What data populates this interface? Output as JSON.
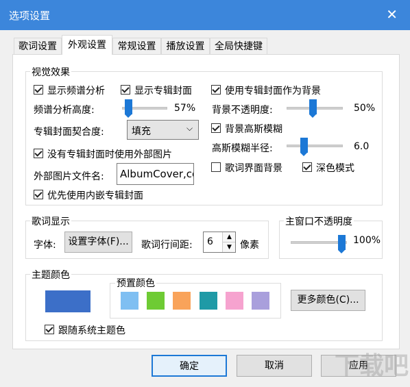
{
  "window": {
    "title": "选项设置",
    "close_glyph": "✕"
  },
  "tabs": [
    {
      "label": "歌词设置",
      "active": false
    },
    {
      "label": "外观设置",
      "active": true
    },
    {
      "label": "常规设置",
      "active": false
    },
    {
      "label": "播放设置",
      "active": false
    },
    {
      "label": "全局快捷键",
      "active": false
    }
  ],
  "visual": {
    "title": "视觉效果",
    "show_spectrum": {
      "label": "显示频谱分析",
      "checked": true
    },
    "show_cover": {
      "label": "显示专辑封面",
      "checked": true
    },
    "spectrum_height": {
      "label": "频谱分析高度:",
      "value": "57%",
      "level": 57
    },
    "cover_fit": {
      "label": "专辑封面契合度:",
      "value": "填充"
    },
    "use_external": {
      "label": "没有专辑封面时使用外部图片",
      "checked": true
    },
    "external_name": {
      "label": "外部图片文件名:",
      "value": "AlbumCover,co"
    },
    "prefer_embedded": {
      "label": "优先使用内嵌专辑封面",
      "checked": true
    },
    "cover_as_bg": {
      "label": "使用专辑封面作为背景",
      "checked": true
    },
    "bg_opacity": {
      "label": "背景不透明度:",
      "value": "50%",
      "level": 50
    },
    "bg_blur": {
      "label": "背景高斯模糊",
      "checked": true
    },
    "blur_radius": {
      "label": "高斯模糊半径:",
      "value": "6.0",
      "level": 30
    },
    "lyric_bg": {
      "label": "歌词界面背景",
      "checked": false
    },
    "dark_mode": {
      "label": "深色模式",
      "checked": true
    }
  },
  "lyrics_display": {
    "title": "歌词显示",
    "font_label": "字体:",
    "set_font_button": "设置字体(F)...",
    "spacing_label": "歌词行间距:",
    "spacing_value": "6",
    "unit": "像素"
  },
  "window_opacity": {
    "title": "主窗口不透明度",
    "value": "100%",
    "level": 100
  },
  "theme": {
    "title": "主题颜色",
    "current_color": "#3c6fc8",
    "preset_title": "预置颜色",
    "presets": [
      "#7fbff2",
      "#6ecb34",
      "#f9a35a",
      "#1f9aa6",
      "#f6a3cf",
      "#a99fdc"
    ],
    "more_button": "更多颜色(C)...",
    "follow_system": {
      "label": "跟随系统主题色",
      "checked": true
    }
  },
  "footer": {
    "ok": "确定",
    "cancel": "取消",
    "apply": "应用"
  },
  "watermark": "下载吧"
}
